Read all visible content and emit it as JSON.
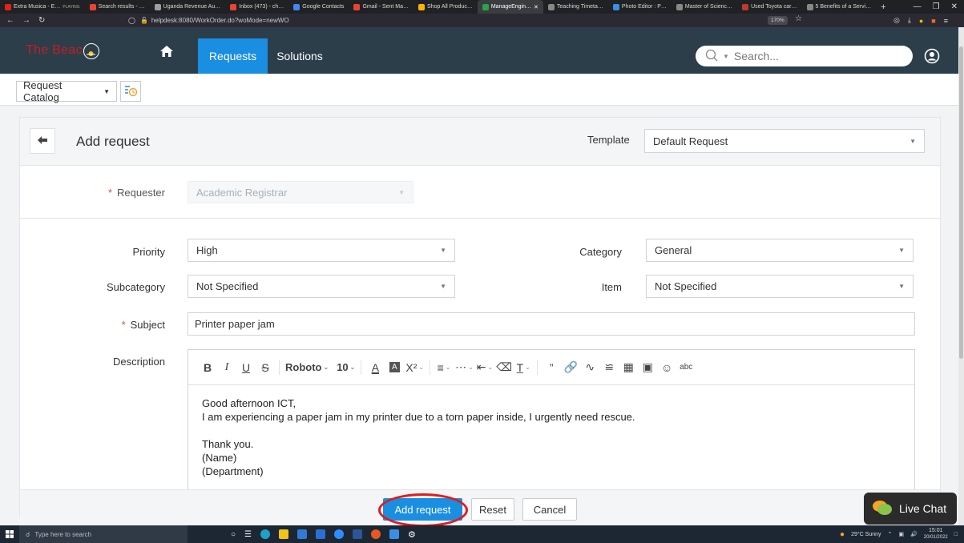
{
  "browser": {
    "tabs": [
      {
        "label": "Extra Musica - E…",
        "sub": "PLAYING",
        "color": "#e62117"
      },
      {
        "label": "Search results - …",
        "color": "#ea4335"
      },
      {
        "label": "Uganda Revenue Au…",
        "color": "#9e9e9e"
      },
      {
        "label": "Inbox (473) - ch…",
        "color": "#ea4335"
      },
      {
        "label": "Google Contacts",
        "color": "#4285f4"
      },
      {
        "label": "Gmail - Sent Ma…",
        "color": "#ea4335"
      },
      {
        "label": "Shop All Produc…",
        "color": "#f7b500"
      },
      {
        "label": "ManageEngin…",
        "color": "#2ba34a",
        "active": true
      },
      {
        "label": "Teaching Timeta…",
        "color": "#888888"
      },
      {
        "label": "Photo Editor : P…",
        "color": "#3a8ee6"
      },
      {
        "label": "Master of Scienc…",
        "color": "#888888"
      },
      {
        "label": "Used Toyota car…",
        "color": "#c0392b"
      },
      {
        "label": "5 Benefits of a Servi…",
        "color": "#888888"
      }
    ],
    "new_tab": "+",
    "url": "helpdesk:8080/WorkOrder.do?woMode=newWO",
    "zoom": "170%"
  },
  "app": {
    "brand": "The Beacon",
    "nav": {
      "requests": "Requests",
      "solutions": "Solutions"
    },
    "search_placeholder": "Search..."
  },
  "toolbar": {
    "catalog": "Request Catalog"
  },
  "form": {
    "title": "Add request",
    "template_label": "Template",
    "template_value": "Default Request",
    "requester_label": "Requester",
    "requester_value": "Academic Registrar",
    "priority_label": "Priority",
    "priority_value": "High",
    "category_label": "Category",
    "category_value": "General",
    "subcategory_label": "Subcategory",
    "subcategory_value": "Not Specified",
    "item_label": "Item",
    "item_value": "Not Specified",
    "subject_label": "Subject",
    "subject_value": "Printer paper jam",
    "description_label": "Description",
    "editor": {
      "font": "Roboto",
      "size": "10"
    },
    "description_lines": [
      "Good afternoon ICT,",
      "I am experiencing a paper jam in my printer due to a torn paper inside, I urgently need rescue.",
      "",
      "Thank you.",
      "(Name)",
      "(Department)"
    ]
  },
  "actions": {
    "add": "Add request",
    "reset": "Reset",
    "cancel": "Cancel"
  },
  "livechat": "Live Chat",
  "taskbar": {
    "search_placeholder": "Type here to search",
    "weather": "29°C  Sunny",
    "time": "15:01",
    "date": "20/01/2022"
  },
  "colors": {
    "header": "#2d3e4b",
    "accent": "#1a8ee1",
    "brand": "#c41e1e",
    "highlight_ring": "#e21b1b"
  }
}
